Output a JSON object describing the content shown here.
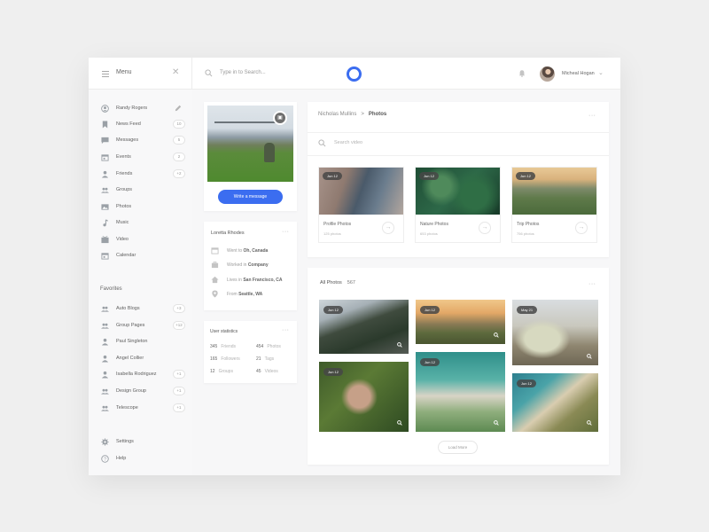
{
  "topbar": {
    "menu_label": "Menu",
    "search_placeholder": "Type in to Search...",
    "user_name": "Micheal Hogan"
  },
  "sidebar": {
    "items": [
      {
        "label": "Randy Rogers",
        "icon": "user-circle-icon",
        "action": "pencil-icon"
      },
      {
        "label": "News Feed",
        "icon": "bookmark-icon",
        "badge": "10"
      },
      {
        "label": "Messages",
        "icon": "chat-icon",
        "badge": "5"
      },
      {
        "label": "Events",
        "icon": "calendar-icon",
        "badge": "2"
      },
      {
        "label": "Friends",
        "icon": "person-icon",
        "badge": "+2"
      },
      {
        "label": "Groups",
        "icon": "group-icon"
      },
      {
        "label": "Photos",
        "icon": "image-icon"
      },
      {
        "label": "Music",
        "icon": "music-note-icon"
      },
      {
        "label": "Video",
        "icon": "video-icon"
      },
      {
        "label": "Calendar",
        "icon": "calendar-icon"
      }
    ],
    "favorites_title": "Favorites",
    "favorites": [
      {
        "label": "Auto Blogs",
        "icon": "group-icon",
        "badge": "+3"
      },
      {
        "label": "Group Pages",
        "icon": "group-icon",
        "badge": "+12"
      },
      {
        "label": "Paul Singleton",
        "icon": "person-icon"
      },
      {
        "label": "Angel Collier",
        "icon": "person-icon"
      },
      {
        "label": "Isabella Rodriguez",
        "icon": "person-icon",
        "badge": "+1"
      },
      {
        "label": "Design Group",
        "icon": "group-icon",
        "badge": "+1"
      },
      {
        "label": "Telescope",
        "icon": "group-icon",
        "badge": "+1"
      }
    ],
    "bottom": [
      {
        "label": "Settings",
        "icon": "gear-icon"
      },
      {
        "label": "Help",
        "icon": "help-icon"
      }
    ]
  },
  "profile": {
    "message_button": "Write a message"
  },
  "about": {
    "name": "Loretta Rhodes",
    "rows": [
      {
        "prefix": "Went to",
        "value": "Oh, Canada",
        "icon": "calendar-icon"
      },
      {
        "prefix": "Worked in",
        "value": "Company",
        "icon": "briefcase-icon"
      },
      {
        "prefix": "Lives in",
        "value": "San Francisco, CA",
        "icon": "home-icon"
      },
      {
        "prefix": "From",
        "value": "Seattle, WA",
        "icon": "pin-icon"
      }
    ]
  },
  "stats": {
    "title": "User statistics",
    "items": [
      {
        "value": "345",
        "label": "Friends"
      },
      {
        "value": "454",
        "label": "Photos"
      },
      {
        "value": "165",
        "label": "Followers"
      },
      {
        "value": "21",
        "label": "Tags"
      },
      {
        "value": "12",
        "label": "Groups"
      },
      {
        "value": "45",
        "label": "Videos"
      }
    ]
  },
  "albums": {
    "breadcrumb_parent": "Nicholas Mullins",
    "breadcrumb_sep": ">",
    "breadcrumb_current": "Photos",
    "search_placeholder": "Search video",
    "items": [
      {
        "date": "Jun 12",
        "name": "Profile Photos",
        "count": "125 photos"
      },
      {
        "date": "Jun 12",
        "name": "Nature Photos",
        "count": "653 photos"
      },
      {
        "date": "Jun 12",
        "name": "Trip Photos",
        "count": "756 photos"
      }
    ]
  },
  "all_photos": {
    "title": "All Photos",
    "count": "567",
    "photos": [
      {
        "date": "Jun 12"
      },
      {
        "date": "Jun 12"
      },
      {
        "date": "Jun 12"
      },
      {
        "date": "Jun 12"
      },
      {
        "date": "May 21"
      },
      {
        "date": "Jun 12"
      }
    ],
    "load_more": "Load More"
  },
  "colors": {
    "accent": "#3b6df0",
    "background": "#efefef",
    "panel": "#f7f7f8"
  }
}
